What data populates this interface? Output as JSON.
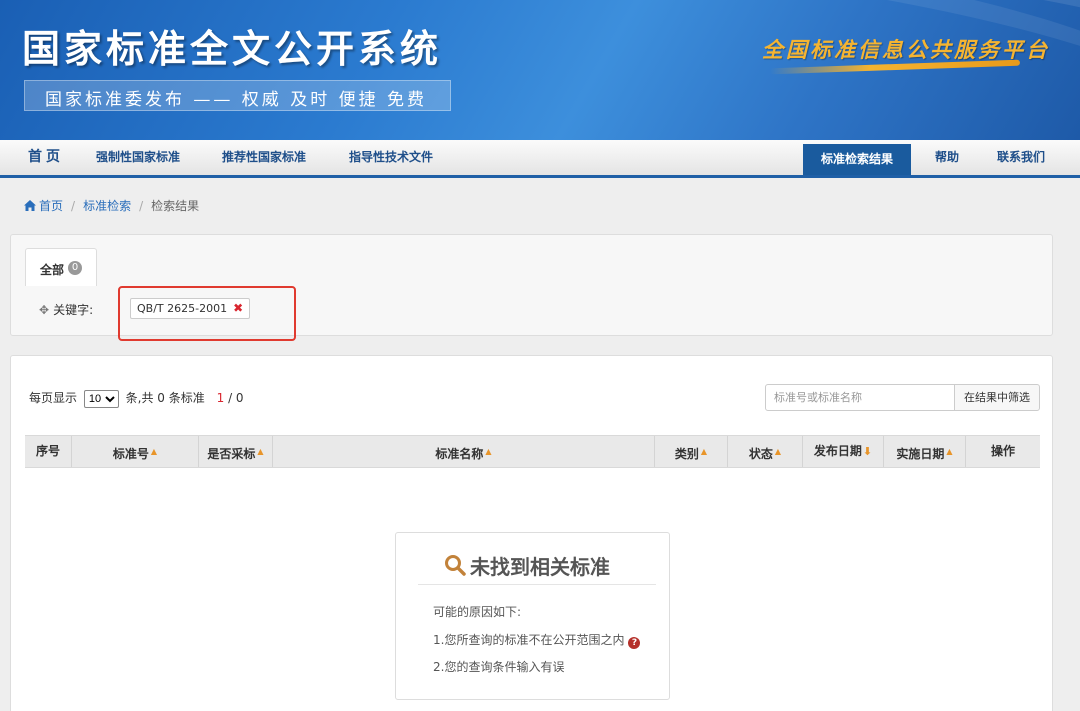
{
  "header": {
    "site_title": "国家标准全文公开系统",
    "slogan": "国家标准委发布 —— 权威 及时 便捷 免费",
    "platform_name": "全国标准信息公共服务平台"
  },
  "nav": {
    "home": "首页",
    "mandatory": "强制性国家标准",
    "recommended": "推荐性国家标准",
    "guidance": "指导性技术文件",
    "search_results": "标准检索结果",
    "help": "帮助",
    "contact": "联系我们"
  },
  "breadcrumb": {
    "home": "首页",
    "search": "标准检索",
    "current": "检索结果"
  },
  "filter": {
    "tab_all": "全部",
    "tab_count": "0",
    "keyword_label": "关键字:",
    "keyword_value": "QB/T 2625-2001",
    "remove_symbol": "✖"
  },
  "results": {
    "per_page_label": "每页显示",
    "per_page_value": "10",
    "total_text": "条,共 0 条标准",
    "page_current": "1",
    "page_total": "/ 0",
    "search_placeholder": "标准号或标准名称",
    "filter_button": "在结果中筛选",
    "columns": [
      "序号",
      "标准号",
      "是否采标",
      "标准名称",
      "类别",
      "状态",
      "发布日期",
      "实施日期",
      "操作"
    ]
  },
  "empty": {
    "title": "未找到相关标准",
    "reasons_title": "可能的原因如下:",
    "reason1": "1.您所查询的标准不在公开范围之内",
    "reason2": "2.您的查询条件输入有误",
    "help_icon_text": "?"
  },
  "colors": {
    "nav_active_bg": "#1a5b9e",
    "link": "#2a6ebb",
    "sort_arrow": "#e8952a",
    "highlight": "#e03a2f"
  }
}
